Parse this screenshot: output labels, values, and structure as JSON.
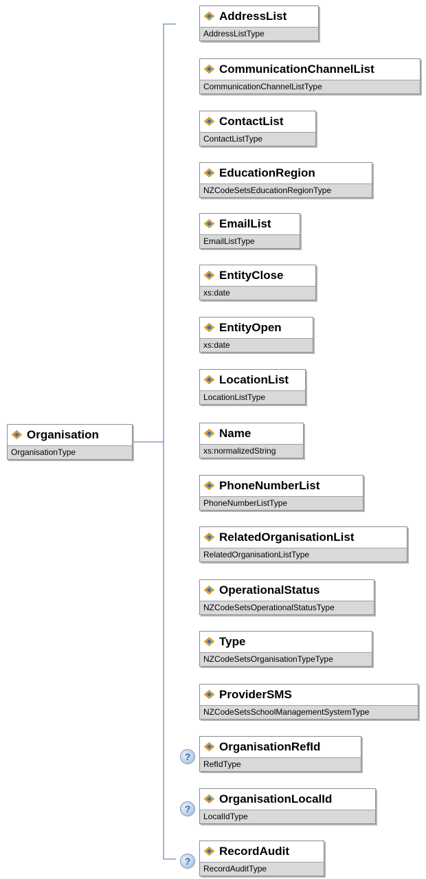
{
  "root": {
    "name": "Organisation",
    "type": "OrganisationType"
  },
  "children": [
    {
      "name": "AddressList",
      "type": "AddressListType",
      "optional": false
    },
    {
      "name": "CommunicationChannelList",
      "type": "CommunicationChannelListType",
      "optional": false
    },
    {
      "name": "ContactList",
      "type": "ContactListType",
      "optional": false
    },
    {
      "name": "EducationRegion",
      "type": "NZCodeSetsEducationRegionType",
      "optional": false
    },
    {
      "name": "EmailList",
      "type": "EmailListType",
      "optional": false
    },
    {
      "name": "EntityClose",
      "type": "xs:date",
      "optional": false
    },
    {
      "name": "EntityOpen",
      "type": "xs:date",
      "optional": false
    },
    {
      "name": "LocationList",
      "type": "LocationListType",
      "optional": false
    },
    {
      "name": "Name",
      "type": "xs:normalizedString",
      "optional": false
    },
    {
      "name": "PhoneNumberList",
      "type": "PhoneNumberListType",
      "optional": false
    },
    {
      "name": "RelatedOrganisationList",
      "type": "RelatedOrganisationListType",
      "optional": false
    },
    {
      "name": "OperationalStatus",
      "type": "NZCodeSetsOperationalStatusType",
      "optional": false
    },
    {
      "name": "Type",
      "type": "NZCodeSetsOrganisationTypeType",
      "optional": false
    },
    {
      "name": "ProviderSMS",
      "type": "NZCodeSetsSchoolManagementSystemType",
      "optional": false
    },
    {
      "name": "OrganisationRefId",
      "type": "RefIdType",
      "optional": true
    },
    {
      "name": "OrganisationLocalId",
      "type": "LocalIdType",
      "optional": true
    },
    {
      "name": "RecordAudit",
      "type": "RecordAuditType",
      "optional": true
    }
  ],
  "optional_marker": "?",
  "colors": {
    "line": "#4a6d9c",
    "type_bg": "#d9d9d9",
    "border": "#8c8c8c"
  }
}
